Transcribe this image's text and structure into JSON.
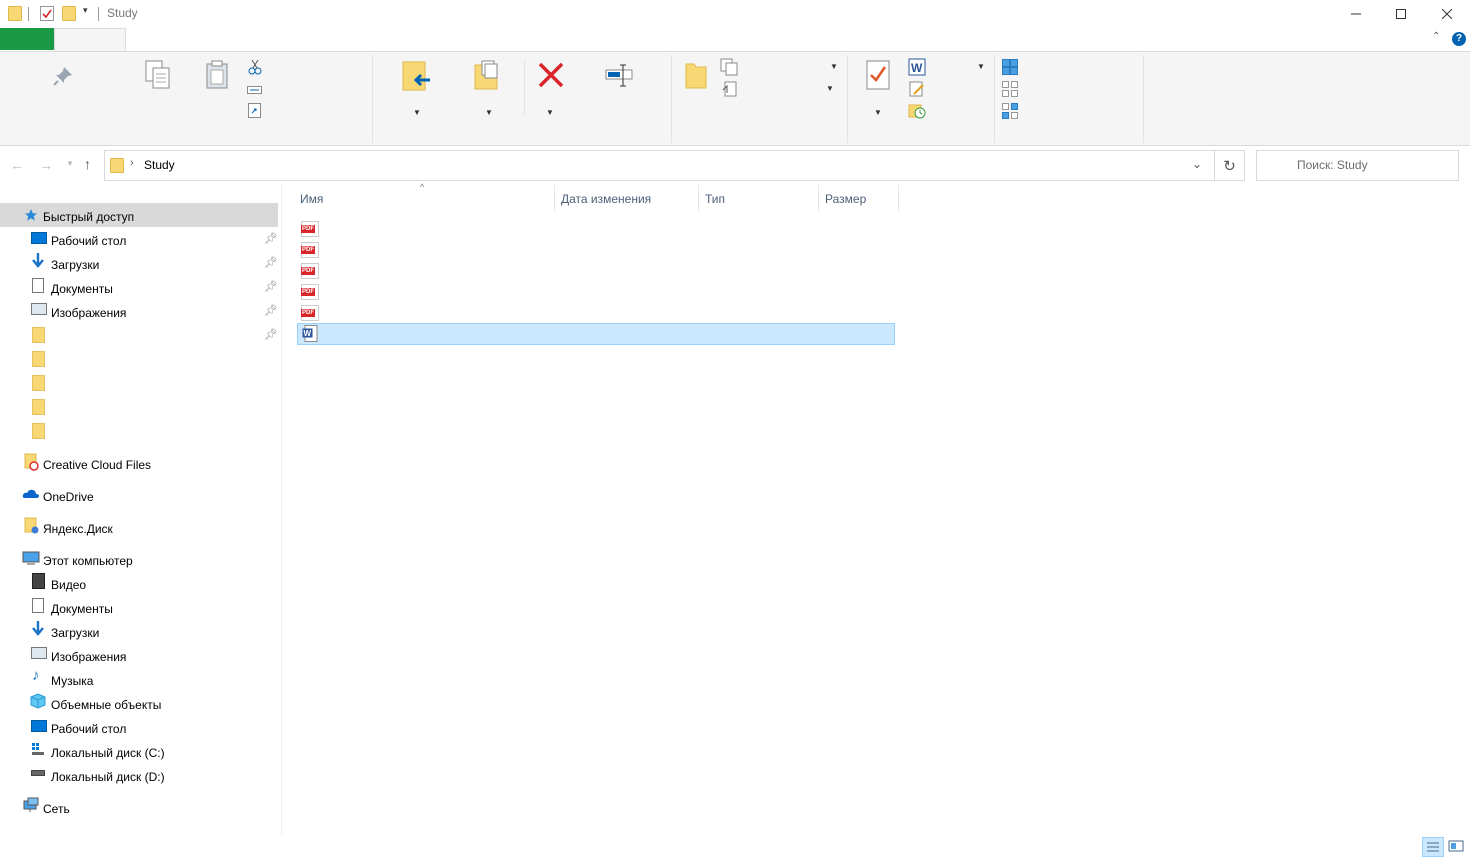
{
  "window": {
    "title": "Study"
  },
  "address": {
    "current_folder": "Study"
  },
  "search": {
    "placeholder": "Поиск: Study"
  },
  "columns": [
    "Имя",
    "Дата изменения",
    "Тип",
    "Размер"
  ],
  "nav": {
    "quick_access": {
      "label": "Быстрый доступ",
      "items": [
        "Рабочий стол",
        "Загрузки",
        "Документы",
        "Изображения"
      ]
    },
    "creative_cloud": "Creative Cloud Files",
    "onedrive": "OneDrive",
    "yandex": "Яндекс.Диск",
    "this_pc": {
      "label": "Этот компьютер",
      "items": [
        "Видео",
        "Документы",
        "Загрузки",
        "Изображения",
        "Музыка",
        "Объемные объекты",
        "Рабочий стол",
        "Локальный диск (C:)",
        "Локальный диск (D:)"
      ]
    },
    "network": "Сеть"
  },
  "files": [
    {
      "type": "pdf",
      "icon": "pdf-icon"
    },
    {
      "type": "pdf",
      "icon": "pdf-icon"
    },
    {
      "type": "pdf",
      "icon": "pdf-icon"
    },
    {
      "type": "pdf",
      "icon": "pdf-icon"
    },
    {
      "type": "pdf",
      "icon": "pdf-icon"
    },
    {
      "type": "docx",
      "icon": "word-doc-icon",
      "selected": true
    }
  ],
  "colors": {
    "file_tab": "#1a9a45",
    "selection": "#cce8ff",
    "nav_selected": "#d9d9d9",
    "accent": "#0063b1"
  }
}
